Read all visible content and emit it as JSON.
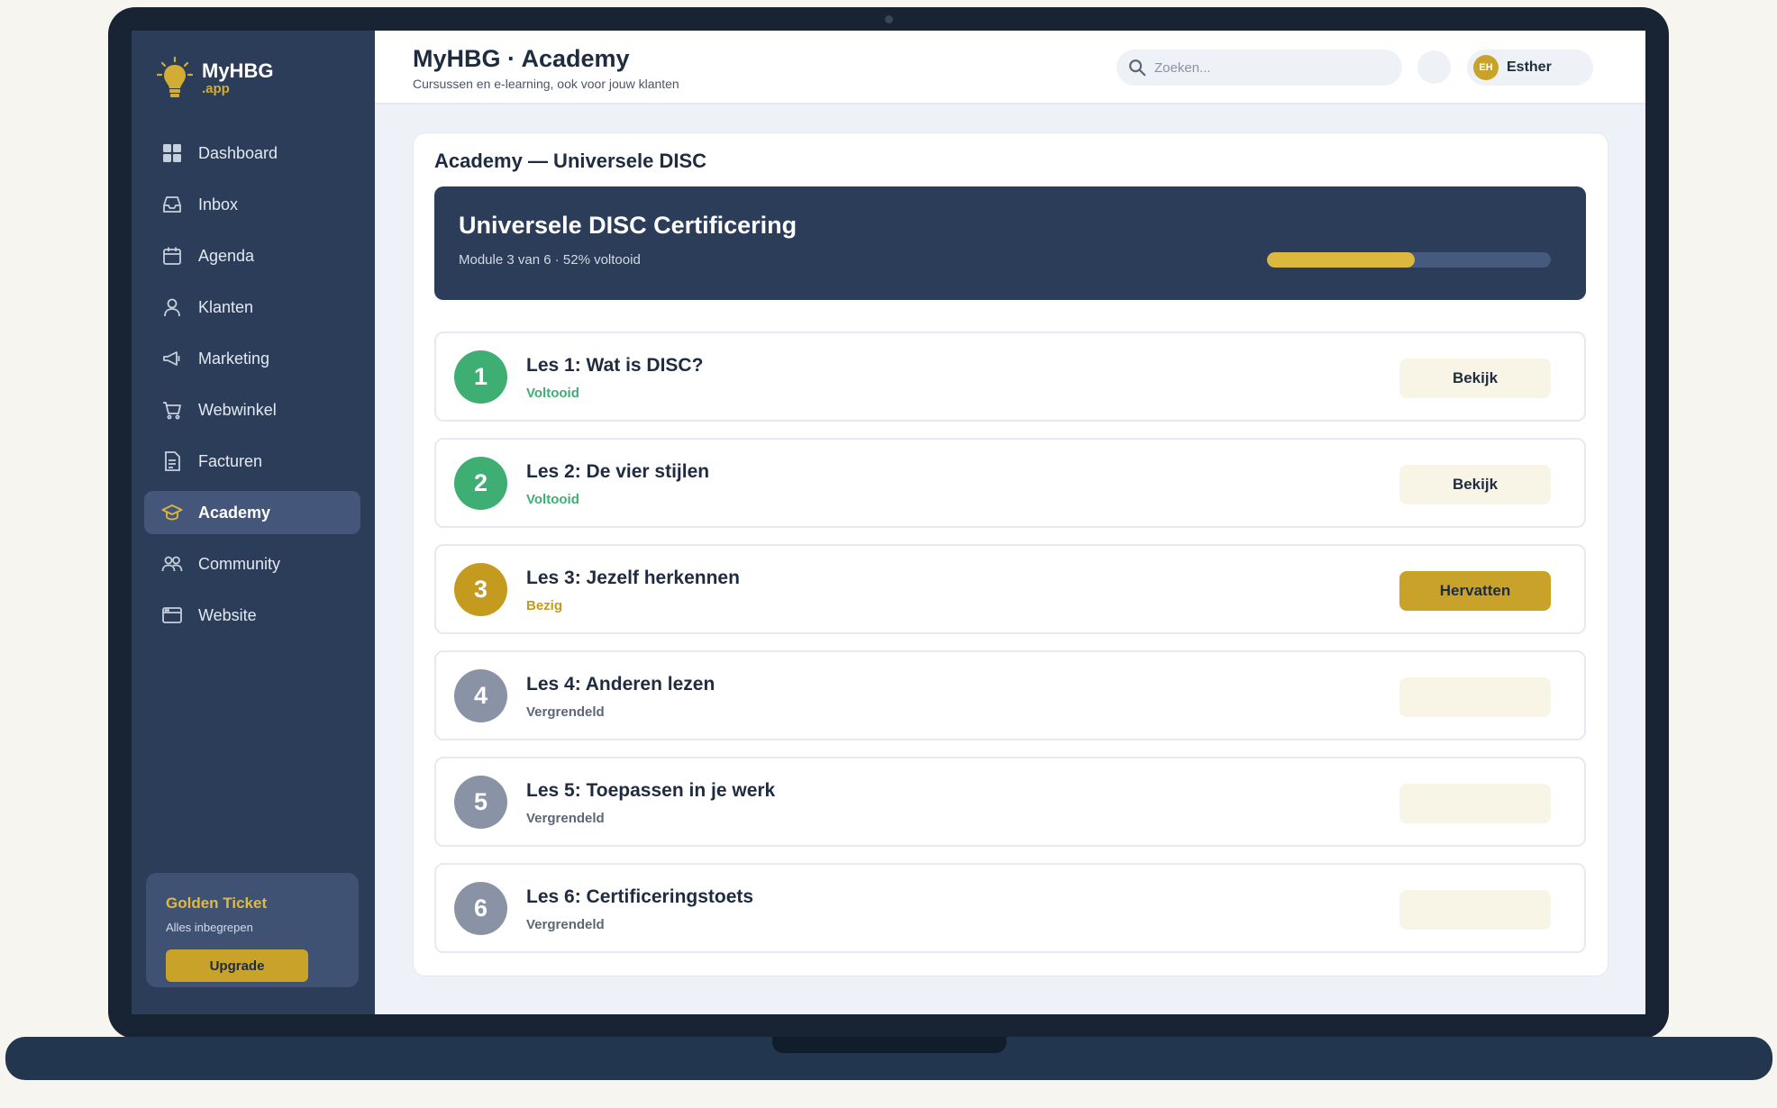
{
  "brand": {
    "name": "MyHBG",
    "sub": ".app"
  },
  "sidebar": {
    "items": [
      {
        "label": "Dashboard",
        "icon": "grid-icon",
        "active": false
      },
      {
        "label": "Inbox",
        "icon": "inbox-icon",
        "active": false
      },
      {
        "label": "Agenda",
        "icon": "calendar-icon",
        "active": false
      },
      {
        "label": "Klanten",
        "icon": "user-icon",
        "active": false
      },
      {
        "label": "Marketing",
        "icon": "megaphone-icon",
        "active": false
      },
      {
        "label": "Webwinkel",
        "icon": "cart-icon",
        "active": false
      },
      {
        "label": "Facturen",
        "icon": "document-icon",
        "active": false
      },
      {
        "label": "Academy",
        "icon": "graduation-cap-icon",
        "active": true
      },
      {
        "label": "Community",
        "icon": "users-icon",
        "active": false
      },
      {
        "label": "Website",
        "icon": "browser-icon",
        "active": false
      }
    ],
    "ticket": {
      "title": "Golden Ticket",
      "subtitle": "Alles inbegrepen",
      "button": "Upgrade"
    }
  },
  "header": {
    "title": "MyHBG · Academy",
    "subtitle": "Cursussen en e-learning, ook voor jouw klanten",
    "search_placeholder": "Zoeken...",
    "user": {
      "initials": "EH",
      "name": "Esther"
    }
  },
  "main": {
    "card_title": "Academy — Universele DISC",
    "course": {
      "title": "Universele DISC Certificering",
      "meta": "Module 3 van 6 · 52% voltooid",
      "progress": 0.52
    },
    "lessons": [
      {
        "num": "1",
        "title": "Les 1: Wat is DISC?",
        "status": "Voltooid",
        "state": "done",
        "button": "Bekijk"
      },
      {
        "num": "2",
        "title": "Les 2: De vier stijlen",
        "status": "Voltooid",
        "state": "done",
        "button": "Bekijk"
      },
      {
        "num": "3",
        "title": "Les 3: Jezelf herkennen",
        "status": "Bezig",
        "state": "active",
        "button": "Hervatten"
      },
      {
        "num": "4",
        "title": "Les 4: Anderen lezen",
        "status": "Vergrendeld",
        "state": "locked",
        "button": ""
      },
      {
        "num": "5",
        "title": "Les 5: Toepassen in je werk",
        "status": "Vergrendeld",
        "state": "locked",
        "button": ""
      },
      {
        "num": "6",
        "title": "Les 6: Certificeringstoets",
        "status": "Vergrendeld",
        "state": "locked",
        "button": ""
      }
    ]
  },
  "colors": {
    "navy": "#2c3d5a",
    "gold": "#c9a22a",
    "done_green": "#3fae73",
    "active_gold": "#c49a1f",
    "locked_gray": "#8a93a6"
  }
}
